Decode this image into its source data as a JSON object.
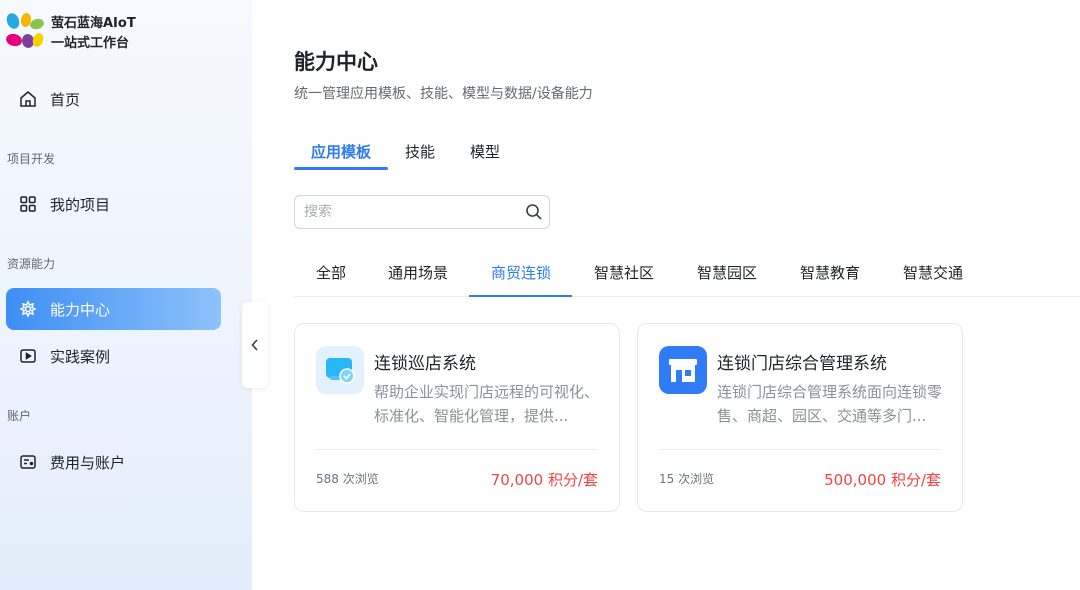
{
  "brand": {
    "name_line1": "萤石蓝海AIoT",
    "name_line2": "一站式工作台"
  },
  "sidebar": {
    "home": {
      "label": "首页",
      "icon": "home-icon"
    },
    "sections": [
      {
        "label": "项目开发",
        "items": [
          {
            "label": "我的项目",
            "icon": "grid-icon"
          }
        ]
      },
      {
        "label": "资源能力",
        "items": [
          {
            "label": "能力中心",
            "icon": "capability-icon",
            "active": true
          },
          {
            "label": "实践案例",
            "icon": "play-case-icon"
          }
        ]
      },
      {
        "label": "账户",
        "items": [
          {
            "label": "费用与账户",
            "icon": "billing-icon"
          }
        ]
      }
    ]
  },
  "main": {
    "title": "能力中心",
    "subtitle": "统一管理应用模板、技能、模型与数据/设备能力",
    "tabs": [
      {
        "label": "应用模板",
        "active": true
      },
      {
        "label": "技能"
      },
      {
        "label": "模型"
      }
    ],
    "search": {
      "placeholder": "搜索",
      "value": ""
    },
    "categories": [
      {
        "label": "全部"
      },
      {
        "label": "通用场景"
      },
      {
        "label": "商贸连锁",
        "active": true
      },
      {
        "label": "智慧社区"
      },
      {
        "label": "智慧园区"
      },
      {
        "label": "智慧教育"
      },
      {
        "label": "智慧交通"
      }
    ],
    "cards": [
      {
        "title": "连锁巡店系统",
        "description": "帮助企业实现门店远程的可视化、标准化、智能化管理，提供...",
        "views": "588 次浏览",
        "price": "70,000 积分/套",
        "icon": "shop-inspection-icon"
      },
      {
        "title": "连锁门店综合管理系统",
        "description": "连锁门店综合管理系统面向连锁零售、商超、园区、交通等多门...",
        "views": "15 次浏览",
        "price": "500,000 积分/套",
        "icon": "store-management-icon"
      }
    ]
  },
  "colors": {
    "accent": "#2f7cf6",
    "price": "#ef4444",
    "active_nav_start": "#3d8ef3",
    "active_nav_end": "#8ec2fb"
  }
}
